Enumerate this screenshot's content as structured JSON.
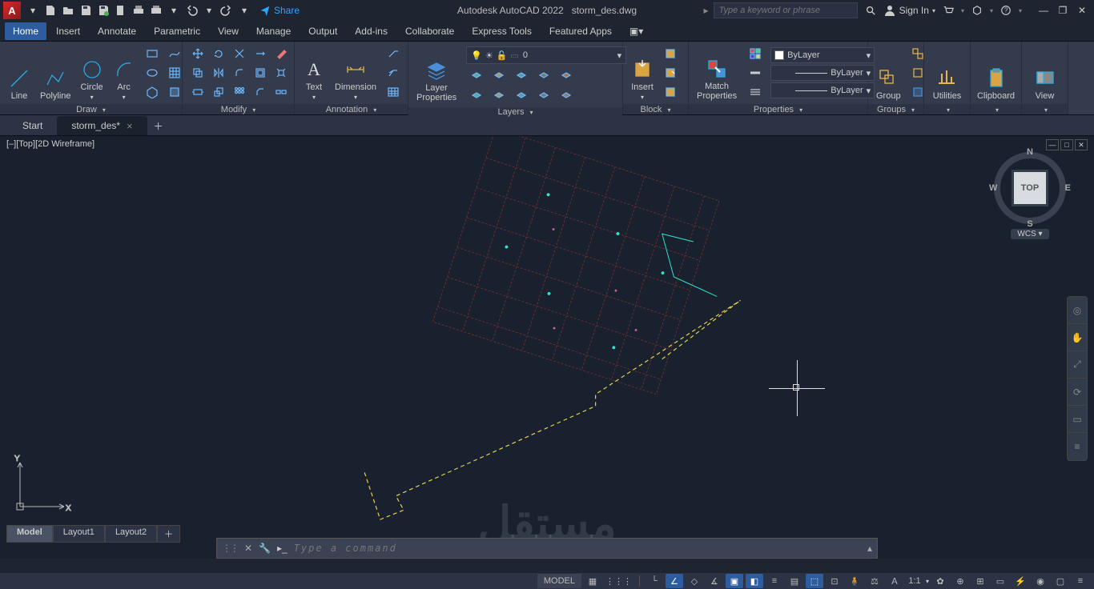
{
  "title": {
    "app": "Autodesk AutoCAD 2022",
    "file": "storm_des.dwg",
    "share": "Share"
  },
  "search": {
    "placeholder": "Type a keyword or phrase",
    "signin": "Sign In"
  },
  "menu": [
    "Home",
    "Insert",
    "Annotate",
    "Parametric",
    "View",
    "Manage",
    "Output",
    "Add-ins",
    "Collaborate",
    "Express Tools",
    "Featured Apps"
  ],
  "ribbon": {
    "draw": {
      "title": "Draw",
      "line": "Line",
      "polyline": "Polyline",
      "circle": "Circle",
      "arc": "Arc"
    },
    "modify": {
      "title": "Modify"
    },
    "annotation": {
      "title": "Annotation",
      "text": "Text",
      "dimension": "Dimension"
    },
    "layers": {
      "title": "Layers",
      "properties": "Layer\nProperties",
      "current": "0"
    },
    "block": {
      "title": "Block",
      "insert": "Insert"
    },
    "properties": {
      "title": "Properties",
      "match": "Match\nProperties",
      "bylayer": "ByLayer"
    },
    "groups": {
      "title": "Groups",
      "group": "Group"
    },
    "utilities": {
      "title": "Utilities"
    },
    "clipboard": {
      "title": "Clipboard"
    },
    "view": {
      "title": "View"
    }
  },
  "filetabs": {
    "start": "Start",
    "active": "storm_des*"
  },
  "viewport": {
    "label": "[–][Top][2D Wireframe]",
    "cube_top": "TOP",
    "wcs": "WCS",
    "n": "N",
    "s": "S",
    "e": "E",
    "w": "W"
  },
  "layout": {
    "model": "Model",
    "l1": "Layout1",
    "l2": "Layout2"
  },
  "cmd": {
    "placeholder": "Type a command"
  },
  "status": {
    "model": "MODEL",
    "scale": "1:1"
  },
  "watermark": "مستقل"
}
